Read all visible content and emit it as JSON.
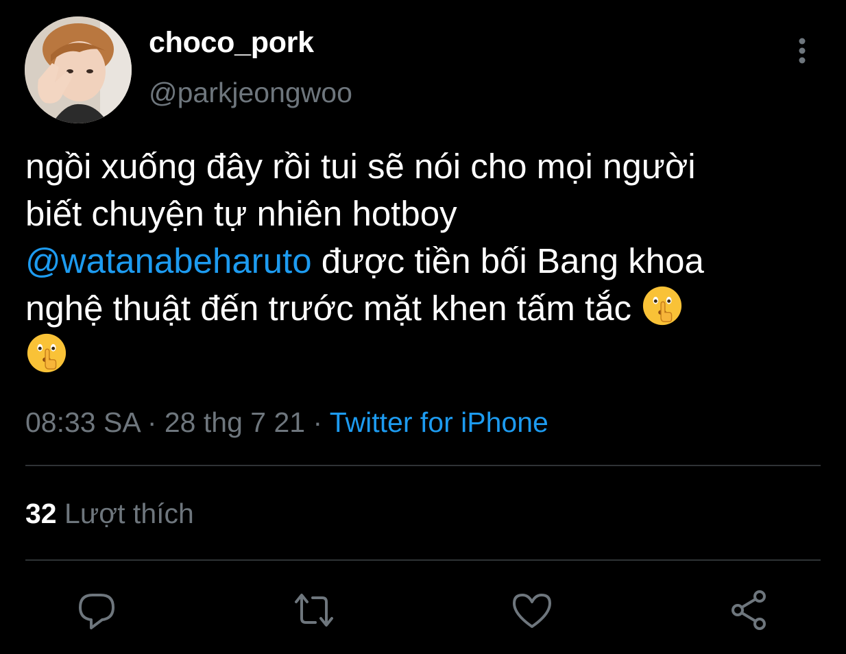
{
  "author": {
    "display_name": "choco_pork",
    "handle": "@parkjeongwoo",
    "avatar_icon": "profile-photo"
  },
  "tweet": {
    "line1": "ngồi xuống đây rồi tui sẽ nói cho mọi người",
    "line2": "biết chuyện tự nhiên hotboy",
    "mention": "@watanabeharuto",
    "line3_rest": " được tiền bối Bang khoa",
    "line4": "nghệ thuật đến trước mặt khen tấm tắc ",
    "emoji_icon": "shushing-face-icon"
  },
  "meta": {
    "time": "08:33 SA",
    "sep1": " · ",
    "date": "28 thg 7 21",
    "sep2": " · ",
    "source": "Twitter for iPhone"
  },
  "stats": {
    "likes_count": "32",
    "likes_label": "Lượt thích"
  },
  "actions": {
    "reply": "reply-icon",
    "retweet": "retweet-icon",
    "like": "heart-icon",
    "share": "share-icon"
  },
  "colors": {
    "background": "#000000",
    "text": "#ffffff",
    "secondary": "#6e767d",
    "accent": "#1d9bf0",
    "divider": "#2f3336"
  }
}
